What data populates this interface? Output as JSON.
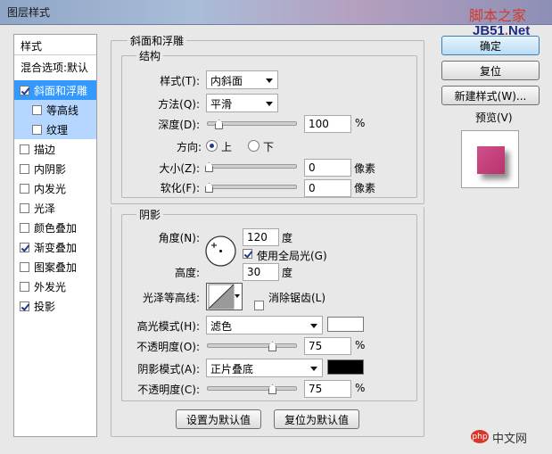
{
  "window": {
    "title": "图层样式"
  },
  "watermark": {
    "line1": "脚本之家",
    "line2a": "JB51",
    "line2dot": ".",
    "line2b": "Net"
  },
  "left_panel": {
    "header": "样式",
    "blend_options": "混合选项:默认",
    "items": [
      {
        "label": "斜面和浮雕",
        "checked": true,
        "selected": true,
        "sub": false
      },
      {
        "label": "等高线",
        "checked": false,
        "selected": false,
        "sub": true
      },
      {
        "label": "纹理",
        "checked": false,
        "selected": false,
        "sub": true
      },
      {
        "label": "描边",
        "checked": false,
        "selected": false,
        "sub": false
      },
      {
        "label": "内阴影",
        "checked": false,
        "selected": false,
        "sub": false
      },
      {
        "label": "内发光",
        "checked": false,
        "selected": false,
        "sub": false
      },
      {
        "label": "光泽",
        "checked": false,
        "selected": false,
        "sub": false
      },
      {
        "label": "颜色叠加",
        "checked": false,
        "selected": false,
        "sub": false
      },
      {
        "label": "渐变叠加",
        "checked": true,
        "selected": false,
        "sub": false
      },
      {
        "label": "图案叠加",
        "checked": false,
        "selected": false,
        "sub": false
      },
      {
        "label": "外发光",
        "checked": false,
        "selected": false,
        "sub": false
      },
      {
        "label": "投影",
        "checked": true,
        "selected": false,
        "sub": false
      }
    ]
  },
  "bevel": {
    "section_title": "斜面和浮雕",
    "structure_title": "结构",
    "style_label": "样式(T):",
    "style_value": "内斜面",
    "technique_label": "方法(Q):",
    "technique_value": "平滑",
    "depth_label": "深度(D):",
    "depth_value": "100",
    "depth_unit": "%",
    "depth_level": 0.1,
    "direction_label": "方向:",
    "direction_up": "上",
    "direction_down": "下",
    "size_label": "大小(Z):",
    "size_value": "0",
    "size_unit": "像素",
    "soften_label": "软化(F):",
    "soften_value": "0",
    "soften_unit": "像素"
  },
  "shading": {
    "title": "阴影",
    "angle_label": "角度(N):",
    "angle_value": "120",
    "angle_unit": "度",
    "global_light_label": "使用全局光(G)",
    "global_light_checked": true,
    "altitude_label": "高度:",
    "altitude_value": "30",
    "altitude_unit": "度",
    "gloss_contour_label": "光泽等高线:",
    "anti_aliased_label": "消除锯齿(L)",
    "anti_aliased_checked": false,
    "highlight_mode_label": "高光模式(H):",
    "highlight_mode_value": "滤色",
    "highlight_color": "#ffffff",
    "highlight_opacity_label": "不透明度(O):",
    "highlight_opacity_value": "75",
    "highlight_opacity_unit": "%",
    "highlight_opacity_level": 0.75,
    "shadow_mode_label": "阴影模式(A):",
    "shadow_mode_value": "正片叠底",
    "shadow_color": "#000000",
    "shadow_opacity_label": "不透明度(C):",
    "shadow_opacity_value": "75",
    "shadow_opacity_unit": "%",
    "shadow_opacity_level": 0.75
  },
  "bottom_buttons": {
    "make_default": "设置为默认值",
    "reset_default": "复位为默认值"
  },
  "right_panel": {
    "ok": "确定",
    "reset": "复位",
    "new_style": "新建样式(W)...",
    "preview_label": "预览(V)",
    "preview_checked": true,
    "preview_swatch_color": "#d0508a"
  },
  "php_logo": {
    "badge": "php",
    "text": "中文网"
  }
}
